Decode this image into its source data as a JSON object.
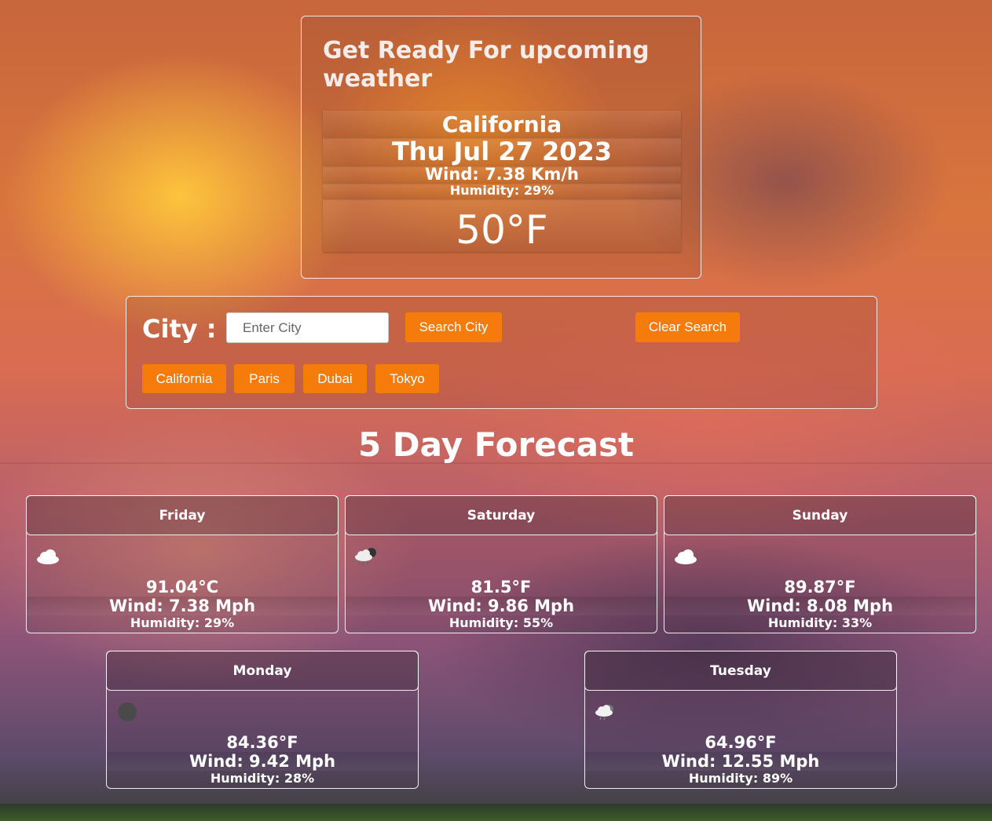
{
  "hero": {
    "title": "Get Ready For upcoming weather",
    "city": "California",
    "date": "Thu Jul 27 2023",
    "wind": "Wind: 7.38 Km/h",
    "humidity": "Humidity: 29%",
    "temp": "50°F"
  },
  "search": {
    "label": "City :",
    "placeholder": "Enter City",
    "value": "",
    "search_button": "Search City",
    "clear_button": "Clear Search",
    "quick_cities": [
      "California",
      "Paris",
      "Dubai",
      "Tokyo"
    ]
  },
  "forecast": {
    "title": "5 Day Forecast",
    "days": [
      {
        "day": "Friday",
        "icon": "cloud-icon",
        "temp": "91.04°C",
        "wind": "Wind: 7.38 Mph",
        "humidity": "Humidity: 29%"
      },
      {
        "day": "Saturday",
        "icon": "rain-cloud-icon",
        "temp": "81.5°F",
        "wind": "Wind: 9.86 Mph",
        "humidity": "Humidity: 55%"
      },
      {
        "day": "Sunday",
        "icon": "cloud-icon",
        "temp": "89.87°F",
        "wind": "Wind: 8.08 Mph",
        "humidity": "Humidity: 33%"
      },
      {
        "day": "Monday",
        "icon": "dark-cloud-icon",
        "temp": "84.36°F",
        "wind": "Wind: 9.42 Mph",
        "humidity": "Humidity: 28%"
      },
      {
        "day": "Tuesday",
        "icon": "light-rain-cloud-icon",
        "temp": "64.96°F",
        "wind": "Wind: 12.55 Mph",
        "humidity": "Humidity: 89%"
      }
    ]
  },
  "colors": {
    "button": "#f57c0a",
    "border": "#ffffff"
  }
}
